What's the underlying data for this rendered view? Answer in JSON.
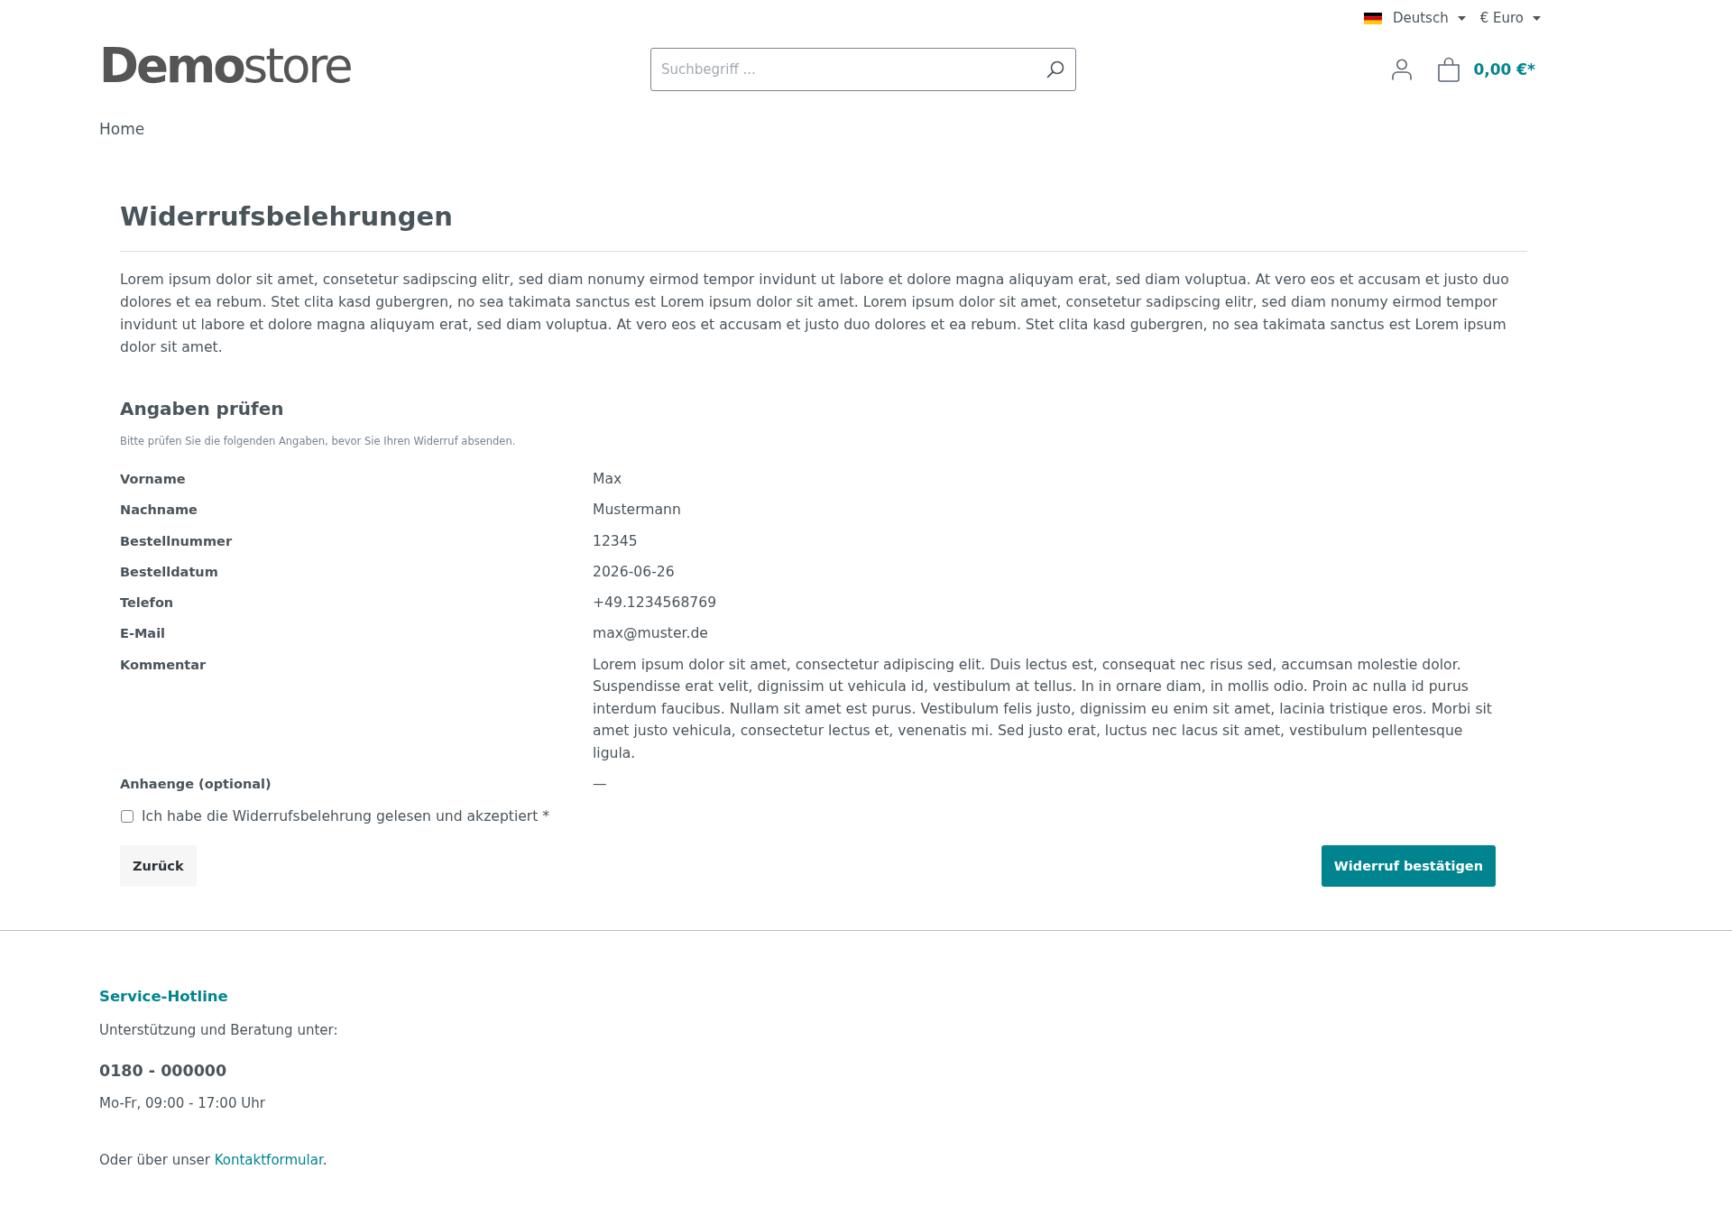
{
  "top_bar": {
    "language": {
      "label": "Deutsch"
    },
    "currency": {
      "label": "€ Euro"
    }
  },
  "header": {
    "logo": "**Demo**store",
    "search": {
      "placeholder": "Suchbegriff ..."
    },
    "cart": {
      "total": "0,00 €*"
    }
  },
  "breadcrumb": [
    {
      "label": "Home"
    }
  ],
  "page": {
    "title": "Widerrufsbelehrungen",
    "intro": "Lorem ipsum dolor sit amet, consetetur sadipscing elitr, sed diam nonumy eirmod tempor invidunt ut labore et dolore magna aliquyam erat, sed diam voluptua. At vero eos et accusam et justo duo dolores et ea rebum. Stet clita kasd gubergren, no sea takimata sanctus est Lorem ipsum dolor sit amet. Lorem ipsum dolor sit amet, consetetur sadipscing elitr, sed diam nonumy eirmod tempor invidunt ut labore et dolore magna aliquyam erat, sed diam voluptua. At vero eos et accusam et justo duo dolores et ea rebum. Stet clita kasd gubergren, no sea takimata sanctus est Lorem ipsum dolor sit amet."
  },
  "review": {
    "heading": "Angaben prüfen",
    "hint": "Bitte prüfen Sie die folgenden Angaben, bevor Sie Ihren Widerruf absenden.",
    "fields": [
      {
        "label": "Vorname",
        "value": "Max"
      },
      {
        "label": "Nachname",
        "value": "Mustermann"
      },
      {
        "label": "Bestellnummer",
        "value": "12345"
      },
      {
        "label": "Bestelldatum",
        "value": "2026-06-26"
      },
      {
        "label": "Telefon",
        "value": "+49.1234568769"
      },
      {
        "label": "E-Mail",
        "value": "max@muster.de"
      },
      {
        "label": "Kommentar",
        "value": "Lorem ipsum dolor sit amet, consectetur adipiscing elit. Duis lectus est, consequat nec risus sed, accumsan molestie dolor. Suspendisse erat velit, dignissim ut vehicula id, vestibulum at tellus. In in ornare diam, in mollis odio. Proin ac nulla id purus interdum faucibus. Nullam sit amet est purus. Vestibulum felis justo, dignissim eu enim sit amet, lacinia tristique eros. Morbi sit amet justo vehicula, consectetur lectus et, venenatis mi. Sed justo erat, luctus nec lacus sit amet, vestibulum pellentesque ligula."
      },
      {
        "label": "Anhaenge (optional)",
        "value": "—"
      }
    ],
    "consent": {
      "label": "Ich habe die Widerrufsbelehrung gelesen und akzeptiert *",
      "checked": false
    },
    "buttons": [
      {
        "label": "Zurück",
        "kind": "back"
      },
      {
        "label": "Widerruf bestätigen",
        "kind": "submit"
      }
    ]
  },
  "footer": {
    "heading": "Service-Hotline",
    "support_text": "Unterstützung und Beratung unter:",
    "phone": "0180 - 000000",
    "hours": "Mo-Fr, 09:00 - 17:00 Uhr",
    "contact": {
      "prefix": "Oder über unser",
      "link": "Kontaktformular",
      "suffix": "."
    }
  }
}
